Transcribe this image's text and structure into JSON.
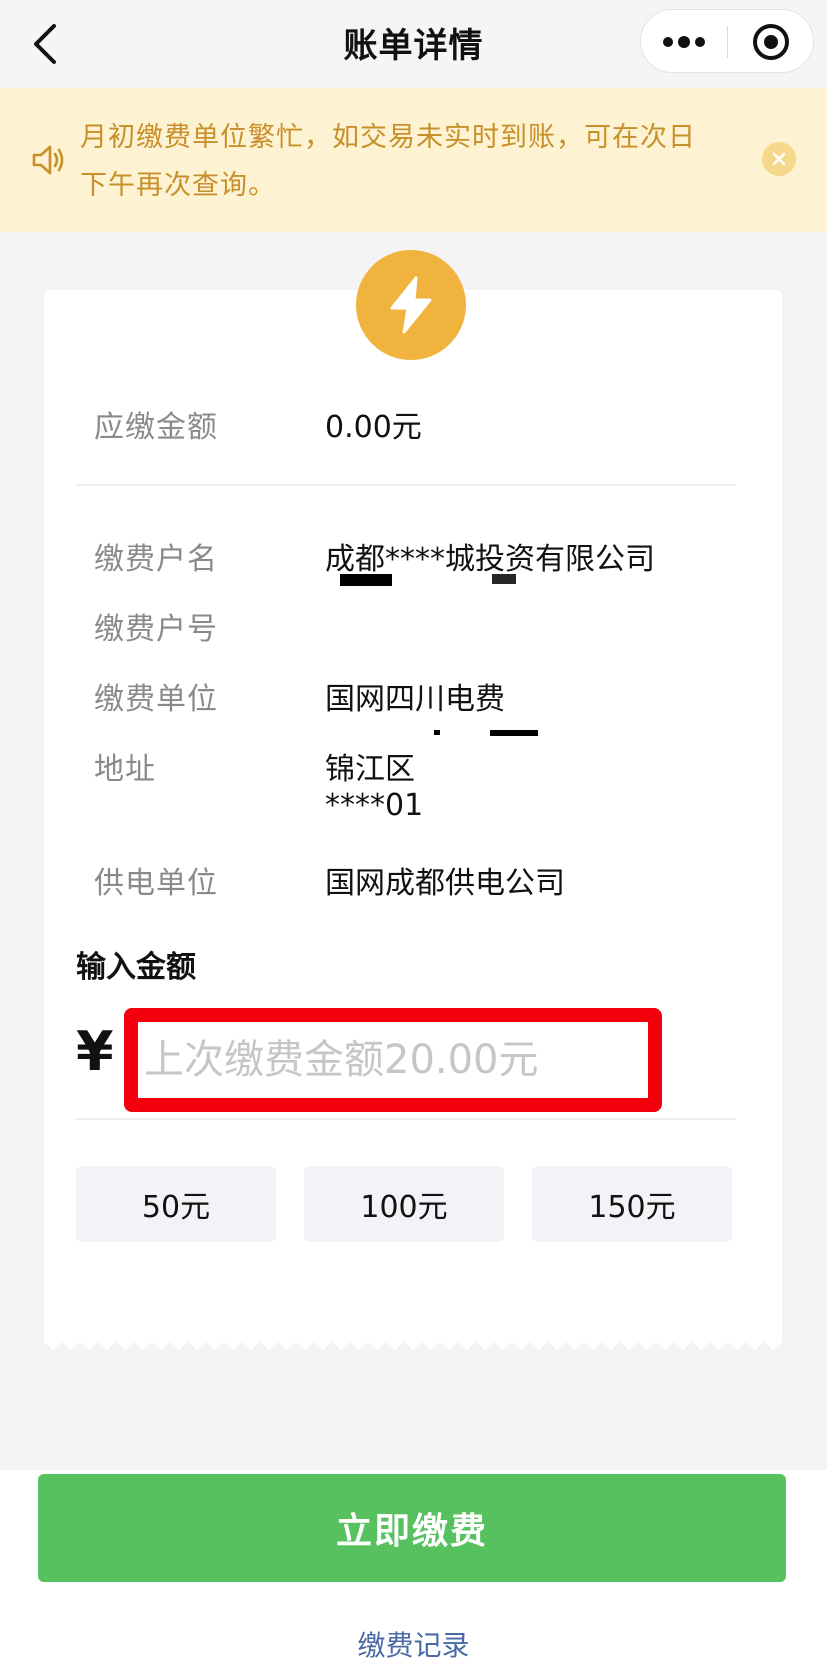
{
  "header": {
    "title": "账单详情",
    "back_icon": "chevron-left-icon",
    "more_icon": "more-dots-icon",
    "close_icon": "target-circle-icon"
  },
  "notice": {
    "text": "月初缴费单位繁忙，如交易未实时到账，可在次日下午再次查询。",
    "icon": "speaker-icon",
    "close_icon": "close-icon",
    "color": "#c8902a",
    "background": "#fdf2d1"
  },
  "card": {
    "badge_icon": "lightning-bolt-icon",
    "badge_color": "#f0b33e",
    "amount_due": {
      "label": "应缴金额",
      "value": "0.00元"
    },
    "details": [
      {
        "label": "缴费户名",
        "value": "成都****城投资有限公司"
      },
      {
        "label": "缴费户号",
        "value": ""
      },
      {
        "label": "缴费单位",
        "value": "国网四川电费"
      },
      {
        "label": "地址",
        "value_line1": "锦江区",
        "value_line2": "****01"
      },
      {
        "label": "供电单位",
        "value": "国网成都供电公司"
      }
    ],
    "input": {
      "title": "输入金额",
      "currency_symbol": "¥",
      "placeholder": "上次缴费金额20.00元"
    },
    "quick_amounts": [
      "50元",
      "100元",
      "150元"
    ]
  },
  "actions": {
    "pay_label": "立即缴费",
    "pay_color": "#57c05f",
    "record_label": "缴费记录"
  }
}
